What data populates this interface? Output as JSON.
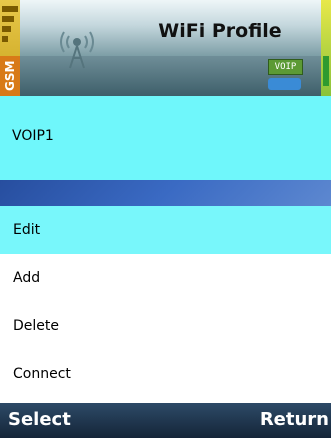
{
  "header": {
    "title": "WiFi Profile",
    "signal_label": "GSM",
    "voip_badge": "VOIP",
    "icons": [
      "signal-strength-icon",
      "wifi-antenna-icon",
      "voip-phone-icon",
      "battery-icon"
    ]
  },
  "profile": {
    "name": "VOIP1"
  },
  "menu": {
    "items": [
      {
        "label": "Edit",
        "selected": true
      },
      {
        "label": "Add",
        "selected": false
      },
      {
        "label": "Delete",
        "selected": false
      },
      {
        "label": "Connect",
        "selected": false
      }
    ]
  },
  "softkeys": {
    "left": "Select",
    "right": "Return"
  },
  "colors": {
    "selection": "#78f7fb",
    "softkey_bar": "#1e344c",
    "band": "#3a6ac3"
  }
}
